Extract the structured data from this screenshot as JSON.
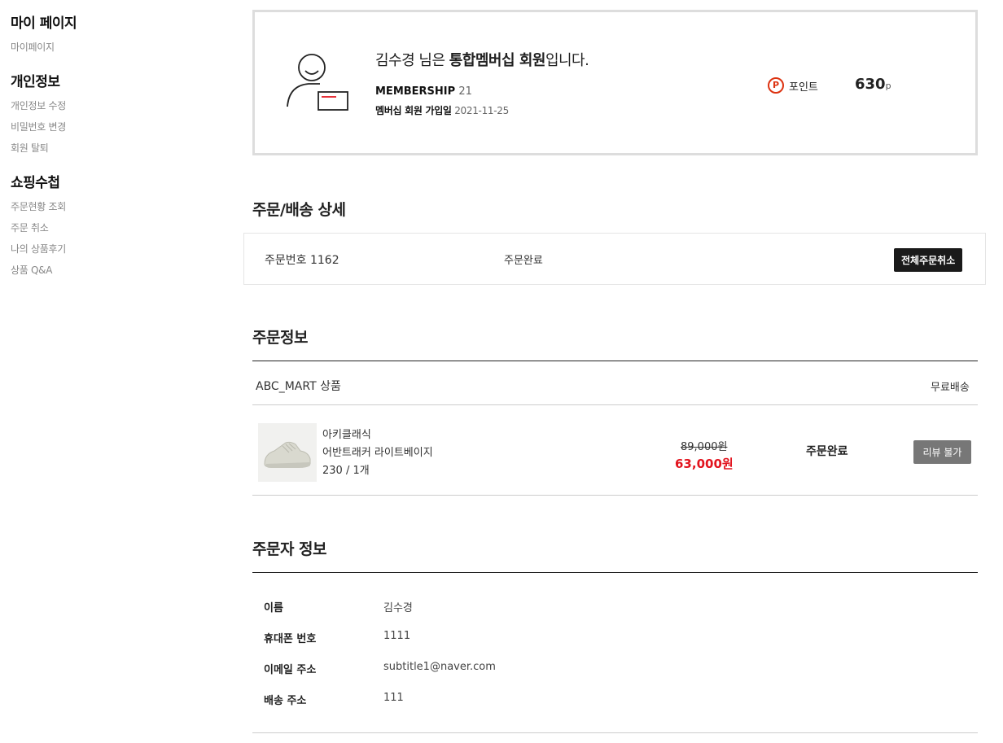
{
  "sidebar": {
    "title": "마이 페이지",
    "mypage_link": "마이페이지",
    "groups": [
      {
        "title": "개인정보",
        "items": [
          "개인정보 수정",
          "비밀번호 변경",
          "회원 탈퇴"
        ]
      },
      {
        "title": "쇼핑수첩",
        "items": [
          "주문현황 조회",
          "주문 취소",
          "나의 상품후기",
          "상품 Q&A"
        ]
      }
    ]
  },
  "member": {
    "name_prefix": "김수경 님은 ",
    "membership_bold": "통합멤버십 회원",
    "name_suffix": "입니다.",
    "membership_label": "MEMBERSHIP",
    "membership_value": "21",
    "join_label": "멤버십 회원 가입일",
    "join_date": "2021-11-25",
    "point_icon": "P",
    "point_label": "포인트",
    "point_value": "630",
    "point_unit": "p"
  },
  "order_detail": {
    "title": "주문/배송 상세",
    "order_no": "주문번호 1162",
    "status": "주문완료",
    "cancel_all": "전체주문취소"
  },
  "order_info": {
    "title": "주문정보",
    "store": "ABC_MART 상품",
    "shipping": "무료배송",
    "item": {
      "brand": "아키클래식",
      "name": "어반트래커 라이트베이지",
      "option": "230 / 1개",
      "original_price": "89,000원",
      "sale_price": "63,000원",
      "status": "주문완료",
      "review_button": "리뷰 불가"
    }
  },
  "orderer": {
    "title": "주문자 정보",
    "rows": [
      {
        "label": "이름",
        "value": "김수경"
      },
      {
        "label": "휴대폰 번호",
        "value": "1111"
      },
      {
        "label": "이메일 주소",
        "value": "subtitle1@naver.com"
      },
      {
        "label": "배송 주소",
        "value": "111"
      }
    ]
  },
  "colors": {
    "accent_red": "#e2141e",
    "dark_button": "#1a1a1a",
    "disabled_button": "#777777"
  }
}
